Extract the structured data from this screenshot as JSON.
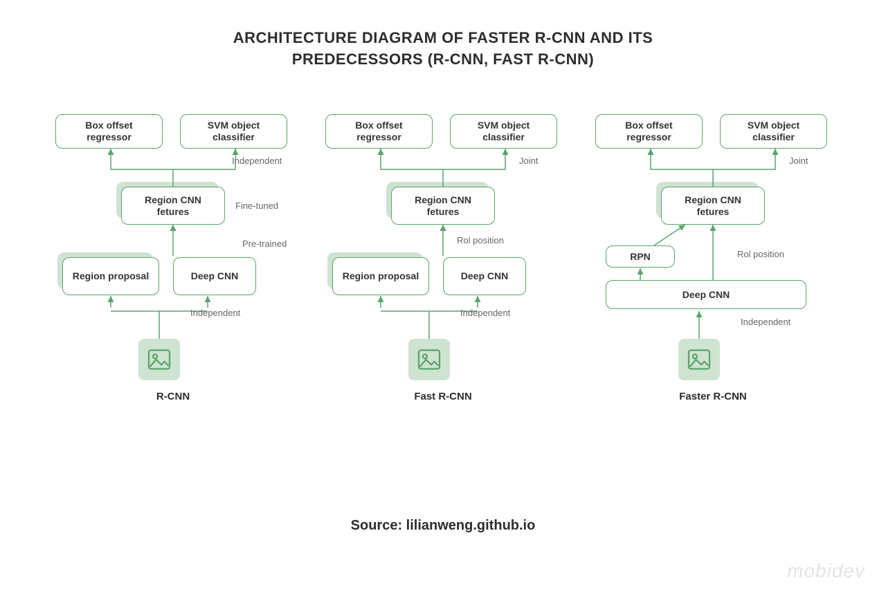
{
  "title_line1": "ARCHITECTURE DIAGRAM OF FASTER R-CNN AND ITS",
  "title_line2": "PREDECESSORS (R-CNN, FAST R-CNN)",
  "source": "Source: lilianweng.github.io",
  "watermark": "mobidev",
  "columns": {
    "rcnn": {
      "caption": "R-CNN",
      "nodes": {
        "box_offset": "Box offset regressor",
        "svm": "SVM object classifier",
        "region_cnn": "Region CNN fetures",
        "region_proposal": "Region proposal",
        "deep_cnn": "Deep CNN"
      },
      "annotations": {
        "a1": "Independent",
        "a2": "Fine-tuned",
        "a3": "Pre-trained",
        "a4": "Independent"
      }
    },
    "fast": {
      "caption": "Fast R-CNN",
      "nodes": {
        "box_offset": "Box offset regressor",
        "svm": "SVM object classifier",
        "region_cnn": "Region CNN fetures",
        "region_proposal": "Region proposal",
        "deep_cnn": "Deep CNN"
      },
      "annotations": {
        "a1": "Joint",
        "a2": "Rol position",
        "a3": "Independent"
      }
    },
    "faster": {
      "caption": "Faster R-CNN",
      "nodes": {
        "box_offset": "Box offset regressor",
        "svm": "SVM object classifier",
        "region_cnn": "Region CNN fetures",
        "rpn": "RPN",
        "deep_cnn": "Deep CNN"
      },
      "annotations": {
        "a1": "Joint",
        "a2": "Rol position",
        "a3": "Independent"
      }
    }
  }
}
